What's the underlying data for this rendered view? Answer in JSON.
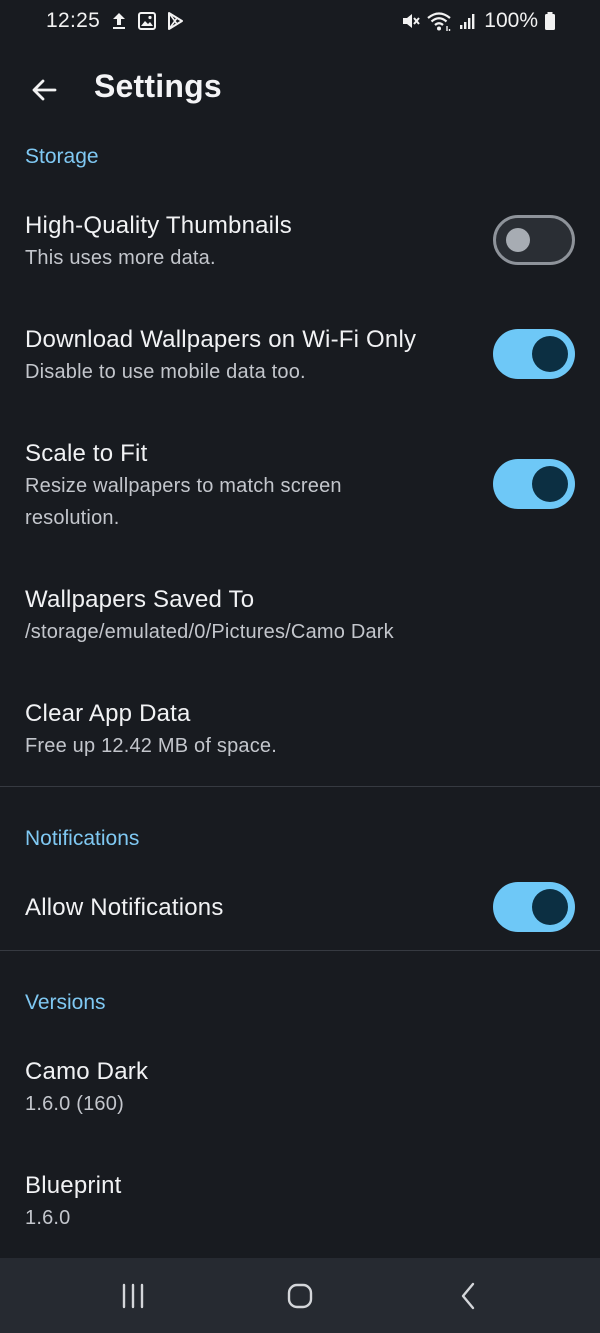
{
  "status_bar": {
    "time": "12:25",
    "battery": "100%",
    "left_icons": [
      "upload-icon",
      "image-icon",
      "play-store-icon"
    ],
    "right_icons": [
      "mute-icon",
      "wifi-icon",
      "signal-icon",
      "battery-icon"
    ]
  },
  "app_bar": {
    "title": "Settings",
    "back_icon": "arrow-left-icon"
  },
  "storage": {
    "header": "Storage",
    "hq_thumbnails": {
      "title": "High-Quality Thumbnails",
      "subtitle": "This uses more data.",
      "enabled": false
    },
    "wifi_only": {
      "title": "Download Wallpapers on Wi-Fi Only",
      "subtitle": "Disable to use mobile data too.",
      "enabled": true
    },
    "scale_to_fit": {
      "title": "Scale to Fit",
      "subtitle_line1": "Resize wallpapers to match screen",
      "subtitle_line2": "resolution.",
      "enabled": true
    },
    "saved_to": {
      "title": "Wallpapers Saved To",
      "subtitle": "/storage/emulated/0/Pictures/Camo Dark"
    },
    "clear_data": {
      "title": "Clear App Data",
      "subtitle": "Free up 12.42 MB of space."
    }
  },
  "notifications": {
    "header": "Notifications",
    "allow": {
      "title": "Allow Notifications",
      "enabled": true
    }
  },
  "versions": {
    "header": "Versions",
    "app": {
      "title": "Camo Dark",
      "subtitle": "1.6.0 (160)"
    },
    "blueprint": {
      "title": "Blueprint",
      "subtitle": "1.6.0"
    }
  },
  "nav_bar": {
    "icons": [
      "recents-icon",
      "home-icon",
      "back-icon"
    ]
  },
  "colors": {
    "background": "#181b20",
    "accent": "#7fc8f2",
    "toggle_on": "#6ec8f7",
    "toggle_thumb_on": "#0c2f42",
    "nav_bar": "#262a31"
  }
}
